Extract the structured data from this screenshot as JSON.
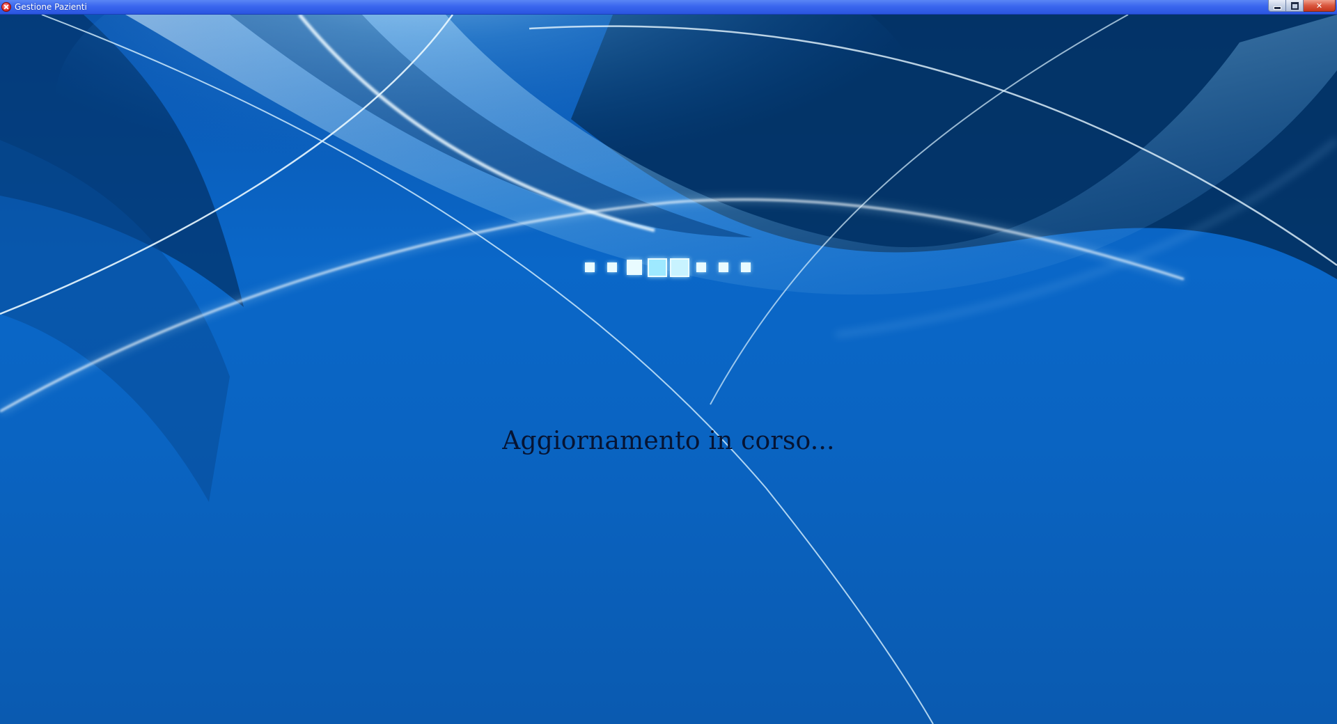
{
  "window": {
    "title": "Gestione Pazienti",
    "app_icon": "red-close-badge-icon",
    "controls": {
      "minimize": "minimize-icon",
      "maximize": "restore-icon",
      "close": "✕"
    }
  },
  "loading": {
    "message": "Aggiornamento in corso...",
    "indicator_icon": "loading-squares-icon",
    "square_color": "#e9fbff",
    "active_square_color": "#9ee9ff"
  },
  "theme": {
    "background": "#0a64c2",
    "titlebar": "#3a66ee"
  }
}
